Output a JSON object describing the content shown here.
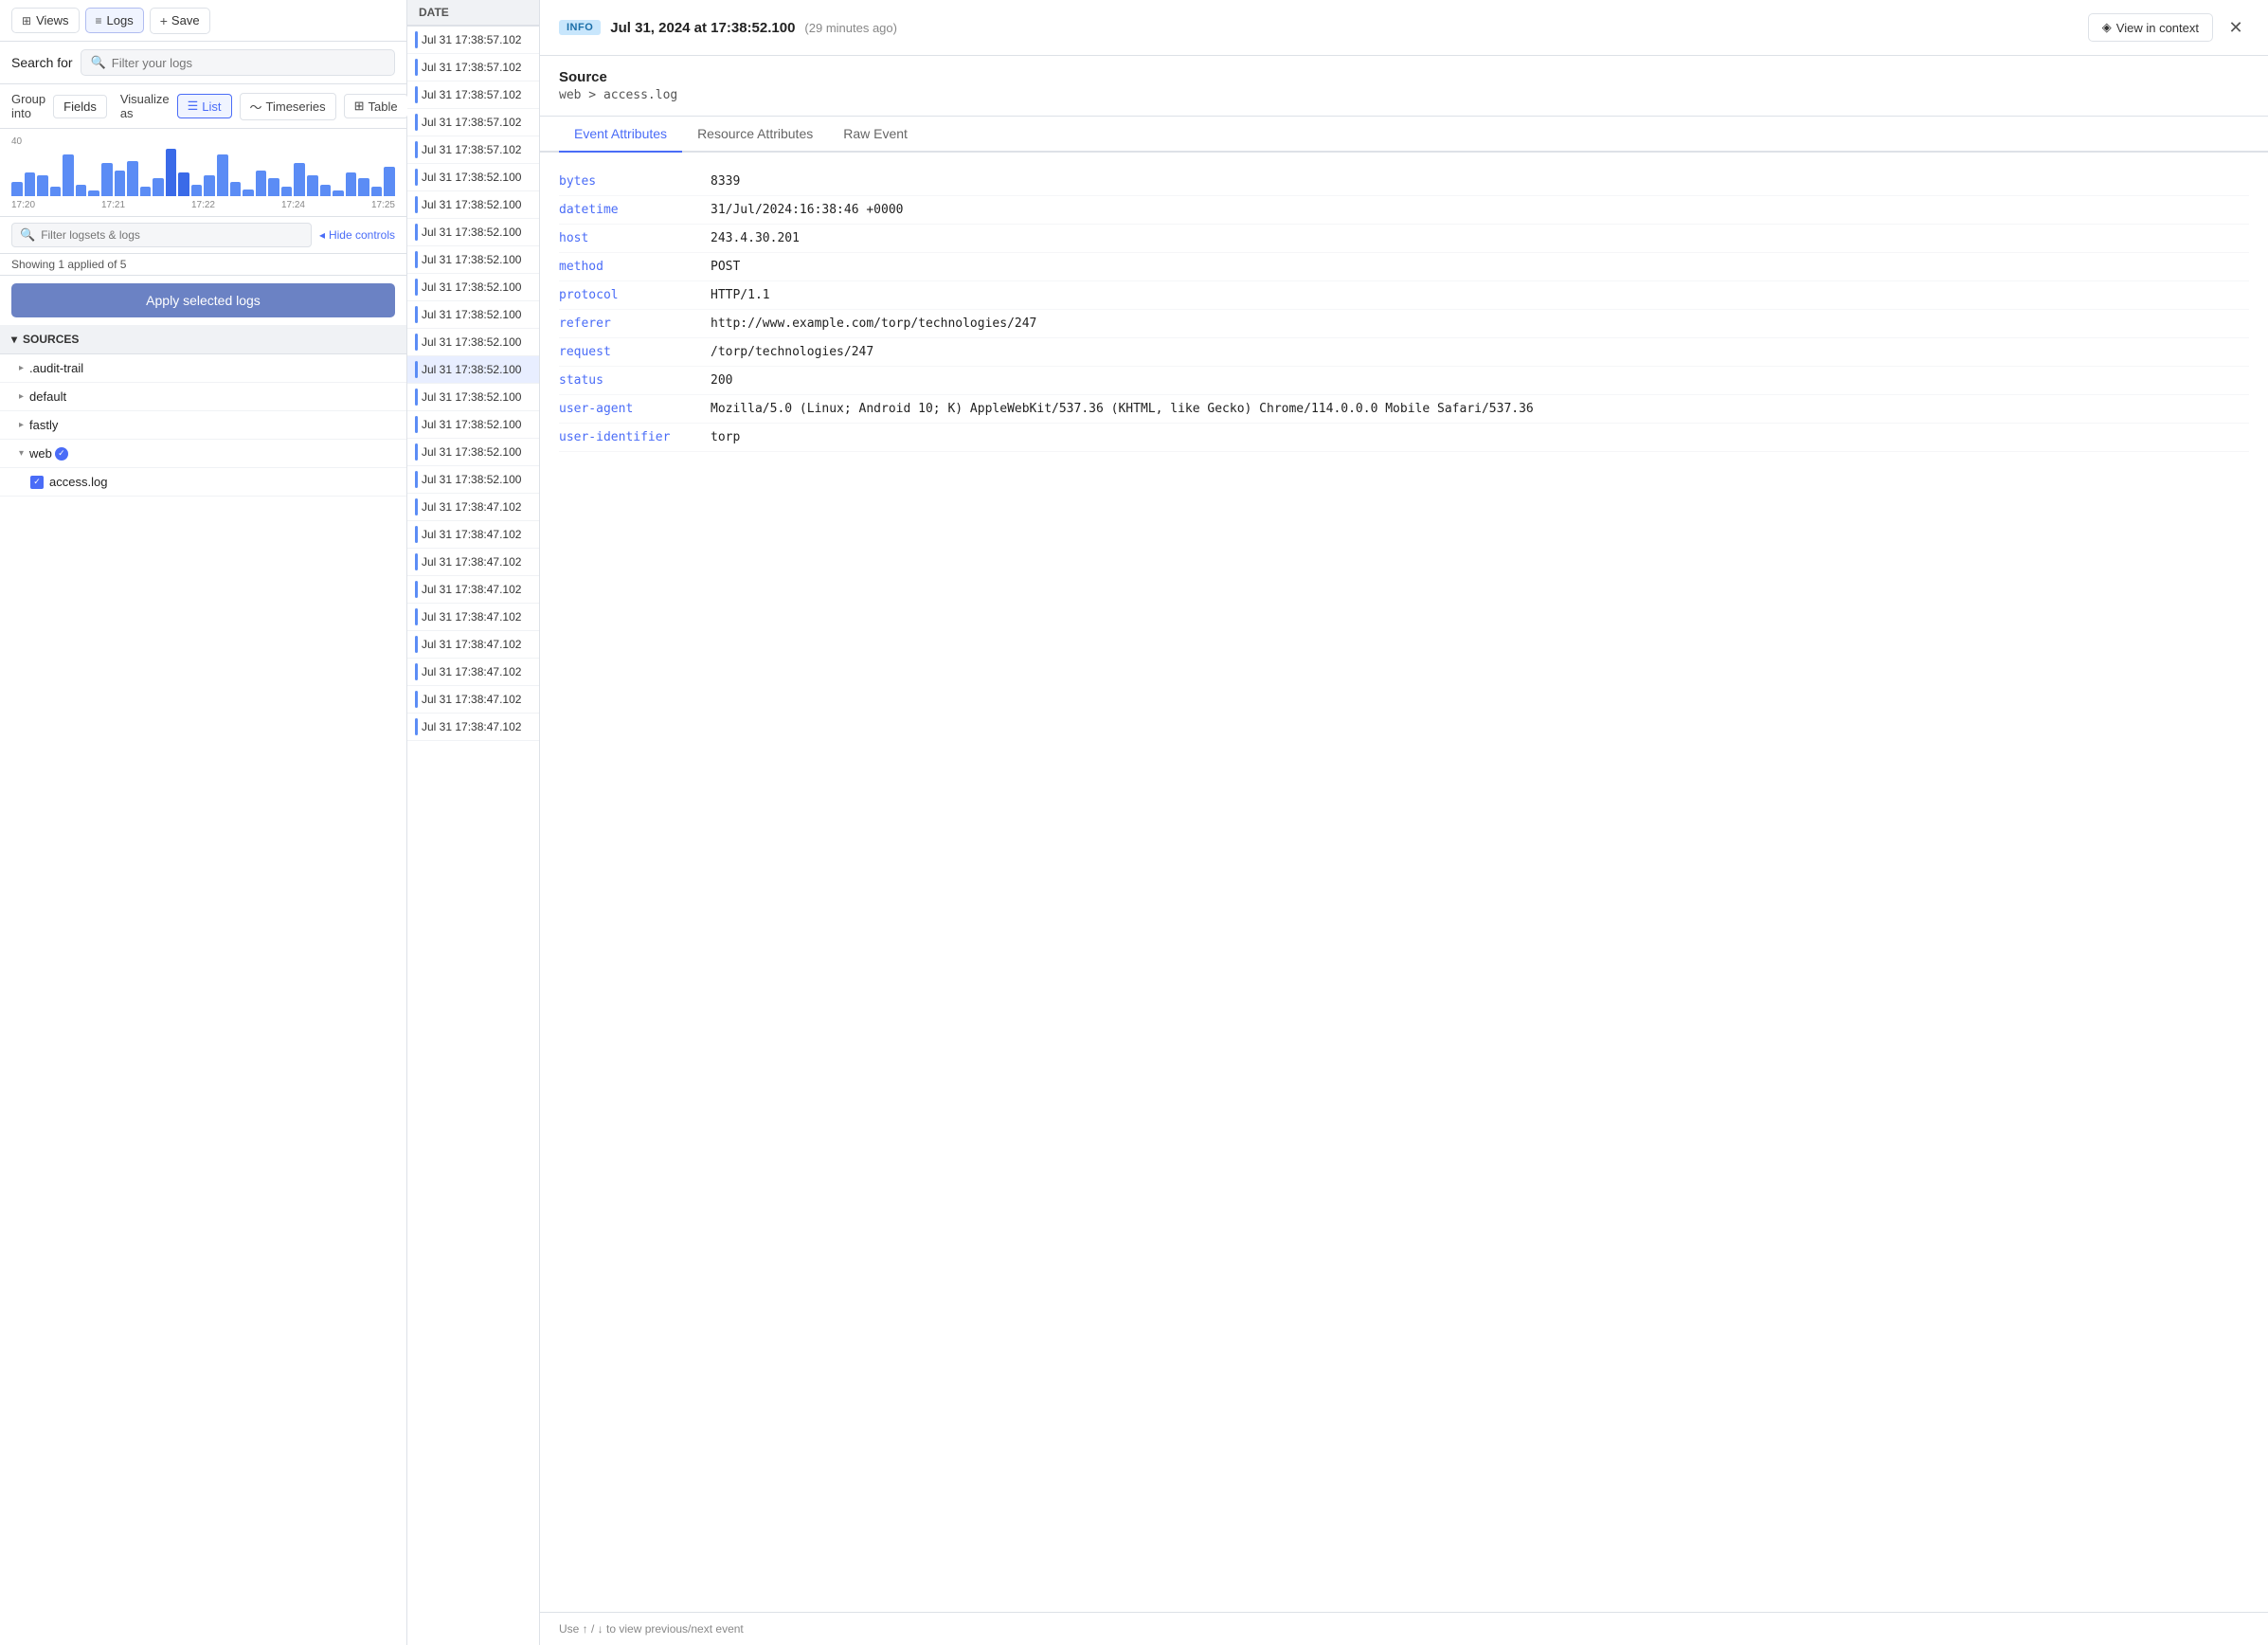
{
  "nav": {
    "views_label": "Views",
    "logs_label": "Logs",
    "save_label": "Save"
  },
  "search": {
    "label": "Search for",
    "placeholder": "Filter your logs"
  },
  "controls": {
    "group_label": "Group into",
    "fields_label": "Fields",
    "visualize_label": "Visualize as",
    "list_label": "List",
    "timeseries_label": "Timeseries",
    "table_label": "Table"
  },
  "chart": {
    "y_max": "40",
    "x_labels": [
      "17:20",
      "17:21",
      "17:22",
      "17:24",
      "17:25"
    ],
    "bars": [
      12,
      20,
      18,
      8,
      35,
      10,
      5,
      28,
      22,
      30,
      8,
      15,
      40,
      20,
      10,
      18,
      35,
      12,
      6,
      22,
      15,
      8,
      28,
      18,
      10,
      5,
      20,
      15,
      8,
      25
    ]
  },
  "filter": {
    "placeholder": "Filter logsets & logs",
    "hide_controls": "Hide controls"
  },
  "status": {
    "text": "Showing 1 applied of 5"
  },
  "apply_btn": {
    "label": "Apply selected logs"
  },
  "sources": {
    "header": "SOURCES",
    "items": [
      {
        "name": ".audit-trail",
        "indent": false,
        "expanded": false,
        "checked": false
      },
      {
        "name": "default",
        "indent": false,
        "expanded": false,
        "checked": false
      },
      {
        "name": "fastly",
        "indent": false,
        "expanded": false,
        "checked": false
      },
      {
        "name": "web",
        "indent": false,
        "expanded": true,
        "checked": true,
        "badge": true
      },
      {
        "name": "access.log",
        "indent": true,
        "checked": true
      }
    ]
  },
  "log_table": {
    "header": "DATE",
    "rows": [
      "Jul 31 17:38:57.102",
      "Jul 31 17:38:57.102",
      "Jul 31 17:38:57.102",
      "Jul 31 17:38:57.102",
      "Jul 31 17:38:57.102",
      "Jul 31 17:38:52.100",
      "Jul 31 17:38:52.100",
      "Jul 31 17:38:52.100",
      "Jul 31 17:38:52.100",
      "Jul 31 17:38:52.100",
      "Jul 31 17:38:52.100",
      "Jul 31 17:38:52.100",
      "Jul 31 17:38:52.100",
      "Jul 31 17:38:52.100",
      "Jul 31 17:38:52.100",
      "Jul 31 17:38:52.100",
      "Jul 31 17:38:52.100",
      "Jul 31 17:38:47.102",
      "Jul 31 17:38:47.102",
      "Jul 31 17:38:47.102",
      "Jul 31 17:38:47.102",
      "Jul 31 17:38:47.102",
      "Jul 31 17:38:47.102",
      "Jul 31 17:38:47.102",
      "Jul 31 17:38:47.102",
      "Jul 31 17:38:47.102"
    ],
    "selected_index": 12
  },
  "event": {
    "level_badge": "INFO",
    "timestamp": "Jul 31, 2024 at 17:38:52.100",
    "ago": "(29 minutes ago)",
    "view_context_label": "View in context",
    "source_title": "Source",
    "source_path": "web > access.log",
    "tabs": [
      "Event Attributes",
      "Resource Attributes",
      "Raw Event"
    ],
    "active_tab": "Event Attributes",
    "attributes": [
      {
        "key": "bytes",
        "value": "8339"
      },
      {
        "key": "datetime",
        "value": "31/Jul/2024:16:38:46 +0000"
      },
      {
        "key": "host",
        "value": "243.4.30.201"
      },
      {
        "key": "method",
        "value": "POST"
      },
      {
        "key": "protocol",
        "value": "HTTP/1.1"
      },
      {
        "key": "referer",
        "value": "http://www.example.com/torp/technologies/247"
      },
      {
        "key": "request",
        "value": "/torp/technologies/247"
      },
      {
        "key": "status",
        "value": "200"
      },
      {
        "key": "user-agent",
        "value": "Mozilla/5.0 (Linux; Android 10; K) AppleWebKit/537.36 (KHTML, like Gecko) Chrome/114.0.0.0 Mobile Safari/537.36"
      },
      {
        "key": "user-identifier",
        "value": "torp"
      }
    ],
    "footer": "Use ↑ / ↓ to view previous/next event"
  }
}
